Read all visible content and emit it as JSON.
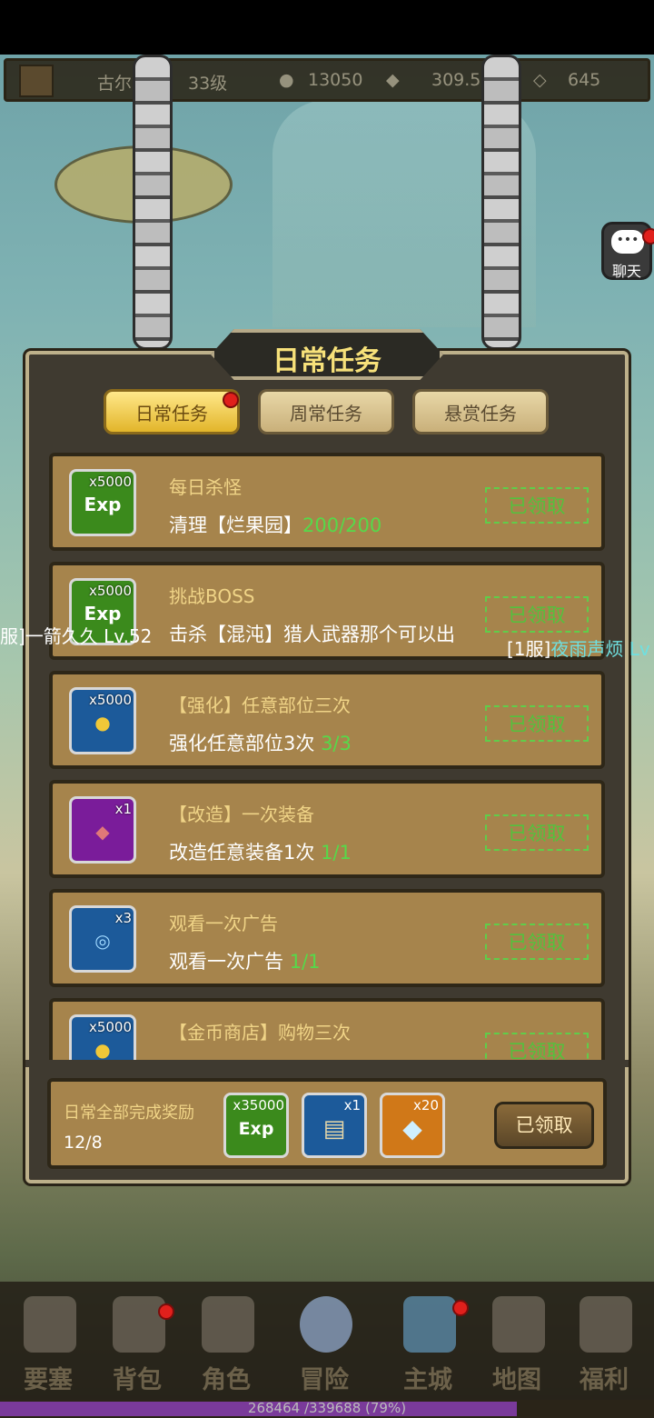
{
  "header": {
    "player_name": "古尔索",
    "level": "33级",
    "stat1": "13050",
    "gold": "309.57",
    "diamonds": "645"
  },
  "chat_button": {
    "label": "聊天"
  },
  "dialog": {
    "title": "日常任务",
    "tabs": [
      {
        "label": "日常任务"
      },
      {
        "label": "周常任务"
      },
      {
        "label": "悬赏任务"
      }
    ],
    "tasks": [
      {
        "qty": "x5000",
        "icon": "exp-icon",
        "name": "每日杀怪",
        "desc": "清理【烂果园】",
        "progress": "200/200",
        "status": "已领取"
      },
      {
        "qty": "x5000",
        "icon": "exp-icon",
        "name": "挑战BOSS",
        "desc": "击杀【混沌】猎人武器那个可以出",
        "progress": "",
        "status": "已领取"
      },
      {
        "qty": "x5000",
        "icon": "gold-icon",
        "name": "【强化】任意部位三次",
        "desc": "强化任意部位3次",
        "progress": "3/3",
        "status": "已领取"
      },
      {
        "qty": "x1",
        "icon": "ore-icon",
        "name": "【改造】一次装备",
        "desc": "改造任意装备1次",
        "progress": "1/1",
        "status": "已领取"
      },
      {
        "qty": "x3",
        "icon": "portal-icon",
        "name": "观看一次广告",
        "desc": "观看一次广告",
        "progress": "1/1",
        "status": "已领取"
      },
      {
        "qty": "x5000",
        "icon": "gold-icon",
        "name": "【金币商店】购物三次",
        "desc": "",
        "progress": "",
        "status": "已领取"
      }
    ],
    "bonus": {
      "label": "日常全部完成奖励",
      "count": "12/8",
      "rewards": [
        {
          "qty": "x35000",
          "icon": "exp-icon"
        },
        {
          "qty": "x1",
          "icon": "scroll-icon"
        },
        {
          "qty": "x20",
          "icon": "diamond-icon"
        }
      ],
      "button": "已领取"
    }
  },
  "chat_overlay": {
    "left": "服]一箭久久 Lv.52",
    "right_prefix": "[1服]",
    "right_name": "夜雨声烦 Lv"
  },
  "nav": [
    {
      "label": "要塞",
      "icon": "fortress-icon"
    },
    {
      "label": "背包",
      "icon": "bag-icon"
    },
    {
      "label": "角色",
      "icon": "helmet-icon"
    },
    {
      "label": "冒险",
      "icon": "portal-icon"
    },
    {
      "label": "主城",
      "icon": "castle-icon"
    },
    {
      "label": "地图",
      "icon": "map-icon"
    },
    {
      "label": "福利",
      "icon": "gift-icon"
    }
  ],
  "exp": {
    "text": "268464 /339688 (79%)",
    "fraction": 0.79
  }
}
